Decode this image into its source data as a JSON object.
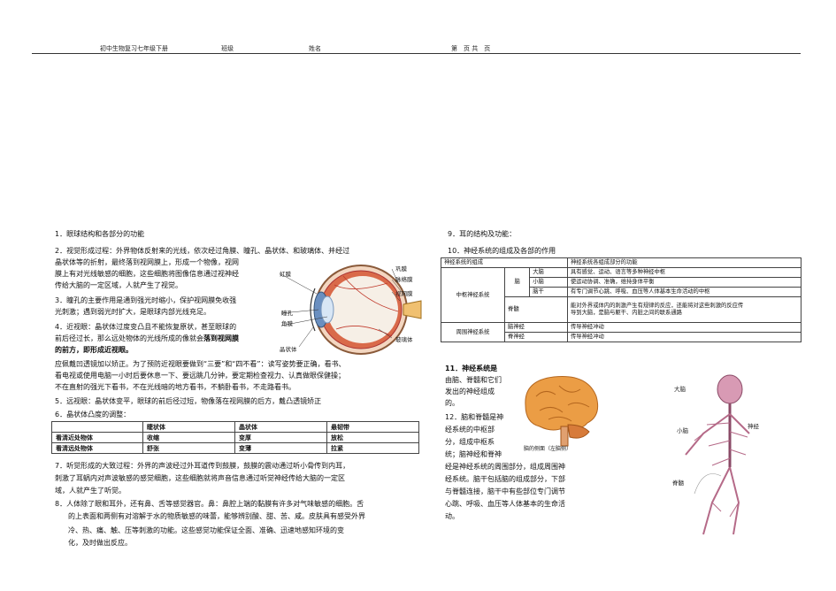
{
  "header": {
    "course": "初中生物复习七年级下册",
    "class_label": "班级",
    "name_label": "姓名",
    "page_label": "第　页 共　页"
  },
  "left": {
    "p1": "1．眼球结构和各部分的功能",
    "p2_l1": "2．视觉形成过程：外界物体反射来的光线，依次经过角膜、瞳孔、晶状体、和玻璃体、并经过",
    "p2_l2": "晶状体等的折射，最终落到视网膜上，形成一个物像，视网",
    "p2_l3": "膜上有对光线敏感的细胞，这些细胞将图像信息通过视神经",
    "p2_l4": "传给大脑的一定区域，人就产生了视觉。",
    "p3_l1": "3．瞳孔的主要作用是通到强光时缩小，保护视网膜免收强",
    "p3_l2": "光刺激；遇到弱光时扩大，是眼球内部光线充足。",
    "p4_l1": "4．近视眼：晶状体过度变凸且不能恢复原状，甚至眼球的",
    "p4_l2a": "前后径过长，那么远处物体的光线所成的像就会",
    "p4_l2b": "落到视网膜",
    "p4_l3": "的前方，即形成近视眼。",
    "p4_l4": "应佩戴凹透镜加以矫正。为了预防近视眼要做到“三要”和“四不看”：读写姿势要正确，看书、",
    "p4_l5": "看电视或使用电脑一小时后要休息一下、要远眺几分钟，要定期检查视力、认真做眼保健操；",
    "p4_l6": "不在直射的强光下看书，不在光线暗的地方看书，不躺卧看书，不走路看书。",
    "p5": "5．远视眼：晶状体变平，眼球的前后径过短，物像落在视网膜的后方，戴凸透镜矫正",
    "p6": "6．晶状体凸度的调整：",
    "table": {
      "headers": [
        "",
        "睫状体",
        "晶状体",
        "悬韧带"
      ],
      "rows": [
        [
          "看清近处物体",
          "收缩",
          "变厚",
          "放松"
        ],
        [
          "看清远处物体",
          "舒张",
          "变薄",
          "拉紧"
        ]
      ]
    },
    "p7_l1": "7．听觉形成的大致过程：外界的声波经过外耳道传到鼓膜，鼓膜的震动通过听小骨传到内耳，",
    "p7_l2": "刺激了耳蜗内对声波敏感的感觉细胞，这些细胞就将声音信息通过听觉神经传给大脑的一定区",
    "p7_l3": "域，人就产生了听觉。",
    "p8_l1": "8．人体除了眼和耳外，还有鼻、舌等感觉器官。鼻：鼻腔上端的黏膜有许多对气味敏感的细胞。舌",
    "p8_l2": "的上表面和两侧有对溶解于水的物质敏感的味蕾，能够辨别酸、甜、苦、咸。皮肤具有感受外界",
    "p8_l3": "冷、热、痛、触、压等刺激的功能。这些感觉功能保证全面、准确、迅速地感知环境的变",
    "p8_l4": "化，及时做出反应。"
  },
  "eye_labels": {
    "hongmo": "虹膜",
    "tongkong": "瞳孔",
    "jiaomo": "角膜",
    "jingzhuangti": "晶状体",
    "gongmo": "巩膜",
    "maiuomo": "脉络膜",
    "shiwangmo": "视网膜",
    "boliti": "玻璃体"
  },
  "right": {
    "p9": "9．耳的结构及功能：",
    "p10": "10．神经系统的组成及各部的作用",
    "nt": {
      "h1": "神经系统的组成",
      "h2": "神经系统各组成部分的功能",
      "zhongshu": "中枢神经系统",
      "nao": "脑",
      "danao": "大脑",
      "danao_f": "具有感觉、运动、语言等多种神经中枢",
      "xiaonao": "小脑",
      "xiaonao_f": "使运动协调、准确，维持身体平衡",
      "naogan": "脑干",
      "naogan_f": "有专门调节心跳、呼吸、血压等人体基本生命活动的中枢",
      "jisui": "脊髓",
      "jisui_f1": "能对外界或体内的刺激产生有规律的反应，还能将对这些刺激的反应传",
      "jisui_f2": "导到大脑，是脑与躯干、内脏之间的联系通路",
      "zhouwei": "周围神经系统",
      "naoshenjing": "脑神经",
      "naoshenjing_f": "传导神经冲动",
      "jishenjing": "脊神经",
      "jishenjing_f": "传导神经冲动"
    },
    "p11_l1": "11．神经系统是",
    "p11_l2": "由脑、脊髓和它们",
    "p11_l3": "发出的神经组成",
    "p11_l4": "的。",
    "p12_l1": "12．脑和脊髓是神",
    "p12_l2": "经系统的中枢部",
    "p12_l3": "分，组成中枢系",
    "p12_l4": "统；脑神经和脊神",
    "p12_l5": "经是神经系统的周围部分，组成周围神",
    "p12_l6": "经系统。脑干包括脑的组成部分，下部",
    "p12_l7": "与脊髓连接，脑干中有些部位专门调节",
    "p12_l8": "心跳、呼吸、血压等人体基本的生命活",
    "p12_l9": "动。",
    "brain_caption": "脑的侧面（左脑侧）",
    "brain_note1": "",
    "body_labels": {
      "danao": "大脑",
      "xiaonao": "小脑",
      "jisui": "脊髓",
      "shenjing": "神经"
    }
  },
  "colors": {
    "brain": "#e89a3c",
    "eye_iris": "#6a8fc0",
    "eye_vessel": "#c0392b",
    "body": "#c86a8a"
  }
}
